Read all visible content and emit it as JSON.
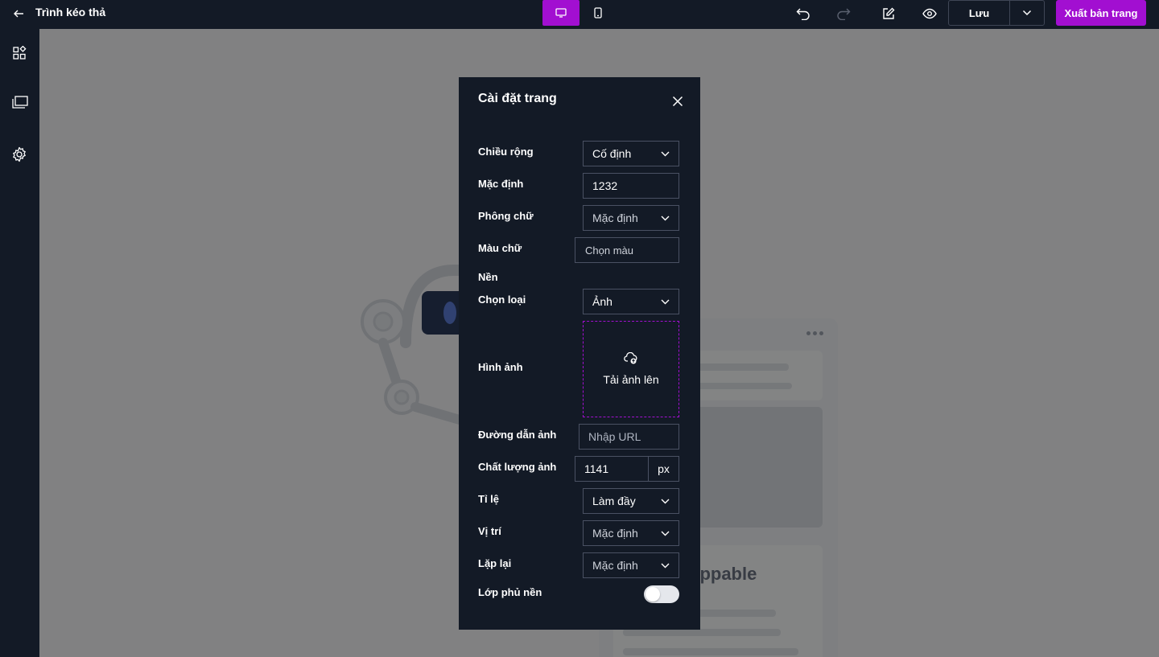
{
  "header": {
    "title": "Trình kéo thả",
    "save_label": "Lưu",
    "export_label": "Xuất bản trang"
  },
  "canvas": {
    "placeholder_text": "oppable"
  },
  "modal": {
    "title": "Cài đặt trang",
    "width": {
      "label": "Chiều rộng",
      "value": "Cố định"
    },
    "default_width": {
      "label": "Mặc định",
      "value": "1232"
    },
    "font": {
      "label": "Phông chữ",
      "value": "Mặc định"
    },
    "text_color": {
      "label": "Màu chữ",
      "value": "Chọn màu"
    },
    "background_section": "Nền",
    "bg_type": {
      "label": "Chọn loại",
      "value": "Ảnh"
    },
    "image": {
      "label": "Hình ảnh",
      "upload_label": "Tải ảnh lên"
    },
    "image_url": {
      "label": "Đường dẫn ảnh",
      "placeholder": "Nhập URL"
    },
    "image_quality": {
      "label": "Chất lượng ảnh",
      "value": "1141",
      "unit": "px"
    },
    "ratio": {
      "label": "Tỉ lệ",
      "value": "Làm đầy"
    },
    "position": {
      "label": "Vị trí",
      "value": "Mặc định"
    },
    "repeat": {
      "label": "Lặp lại",
      "value": "Mặc định"
    },
    "overlay": {
      "label": "Lớp phủ nền",
      "enabled": false
    }
  },
  "colors": {
    "accent": "#a20fd1",
    "panel_bg": "#131a26"
  }
}
